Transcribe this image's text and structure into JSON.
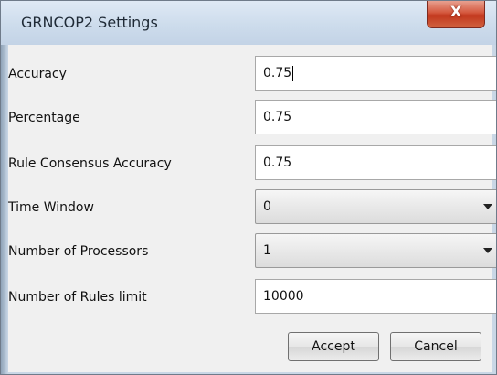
{
  "window": {
    "title": "GRNCOP2 Settings",
    "close_glyph": "X"
  },
  "form": {
    "fields": [
      {
        "label": "Accuracy",
        "value": "0.75",
        "type": "text",
        "focused": true
      },
      {
        "label": "Percentage",
        "value": "0.75",
        "type": "text"
      },
      {
        "label": "Rule Consensus Accuracy",
        "value": "0.75",
        "type": "text"
      },
      {
        "label": "Time Window",
        "value": "0",
        "type": "select"
      },
      {
        "label": "Number of Processors",
        "value": "1",
        "type": "select"
      },
      {
        "label": "Number of Rules limit",
        "value": "10000",
        "type": "text"
      }
    ]
  },
  "buttons": {
    "accept_label": "Accept",
    "cancel_label": "Cancel"
  },
  "icons": {
    "close": "close-icon",
    "dropdown": "chevron-down-icon"
  },
  "colors": {
    "close_button": "#c8432a",
    "titlebar": "#cfdeee",
    "client_background": "#f0f0f0"
  }
}
